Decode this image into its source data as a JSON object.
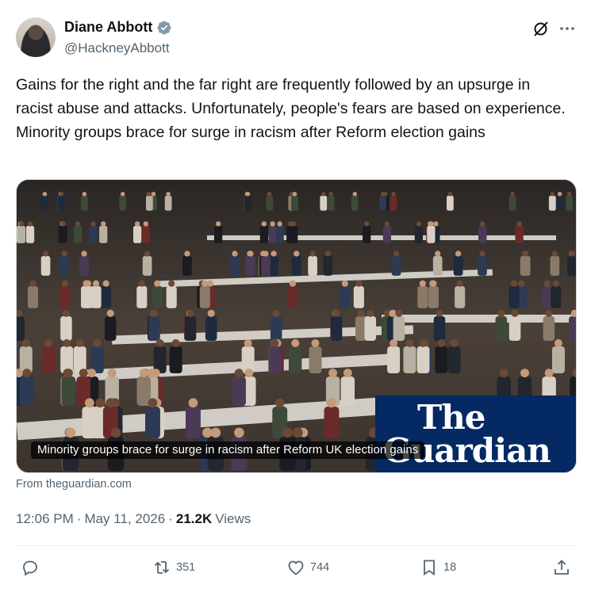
{
  "author": {
    "name": "Diane Abbott",
    "handle": "@HackneyAbbott",
    "verified_color": "#829aab"
  },
  "tweet": {
    "text": "Gains for the right and the far right are frequently followed by an upsurge in racist abuse and attacks. Unfortunately, people's fears are based on experience. Minority groups brace for surge in racism after Reform election gains"
  },
  "card": {
    "brand_line1": "The",
    "brand_line2": "Guardian",
    "brand_color": "#052962",
    "caption": "Minority groups brace for surge in racism after Reform UK election gains",
    "source": "From theguardian.com"
  },
  "meta": {
    "time": "12:06 PM",
    "separator": "·",
    "date": "May 11, 2026",
    "views_count": "21.2K",
    "views_label": "Views"
  },
  "actions": {
    "retweets": "351",
    "likes": "744",
    "bookmarks": "18"
  },
  "icons": {
    "header": [
      "grok-icon",
      "more-icon"
    ],
    "actions": [
      "reply-icon",
      "retweet-icon",
      "like-icon",
      "bookmark-icon",
      "share-icon"
    ]
  }
}
